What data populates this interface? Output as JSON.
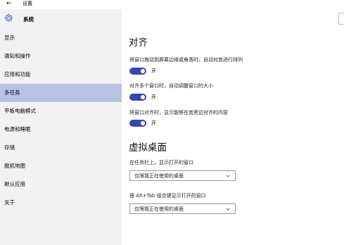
{
  "window": {
    "back_icon": "arrow-left",
    "title": "设置"
  },
  "sidebar": {
    "header_icon": "gear-icon",
    "header_label": "系统",
    "items": [
      {
        "label": "显示"
      },
      {
        "label": "通知和操作"
      },
      {
        "label": "应用和功能"
      },
      {
        "label": "多任务",
        "active": true
      },
      {
        "label": "平板电脑模式"
      },
      {
        "label": "电源和睡眠"
      },
      {
        "label": "存储"
      },
      {
        "label": "脱机地图"
      },
      {
        "label": "默认应用"
      },
      {
        "label": "关于"
      }
    ]
  },
  "snap": {
    "title": "对齐",
    "settings": [
      {
        "label": "将窗口拖动到屏幕边缘或角落时，自动对其进行排列",
        "state": "开"
      },
      {
        "label": "对齐多个窗口时，自动调整窗口的大小",
        "state": "开"
      },
      {
        "label": "将窗口对齐时，显示能够在其旁边对齐的内容",
        "state": "开"
      }
    ]
  },
  "virtual_desktops": {
    "title": "虚拟桌面",
    "taskbar_label": "在任务栏上，显示打开的窗口",
    "taskbar_value": "仅限我正在使用的桌面",
    "alttab_label": "按 Alt+Tab 组合键显示打开的窗口",
    "alttab_value": "仅限我正在使用的桌面"
  },
  "colors": {
    "accent": "#3348b5",
    "active_nav": "#b7c2e4",
    "sidebar_bg": "#f2f2f2"
  }
}
